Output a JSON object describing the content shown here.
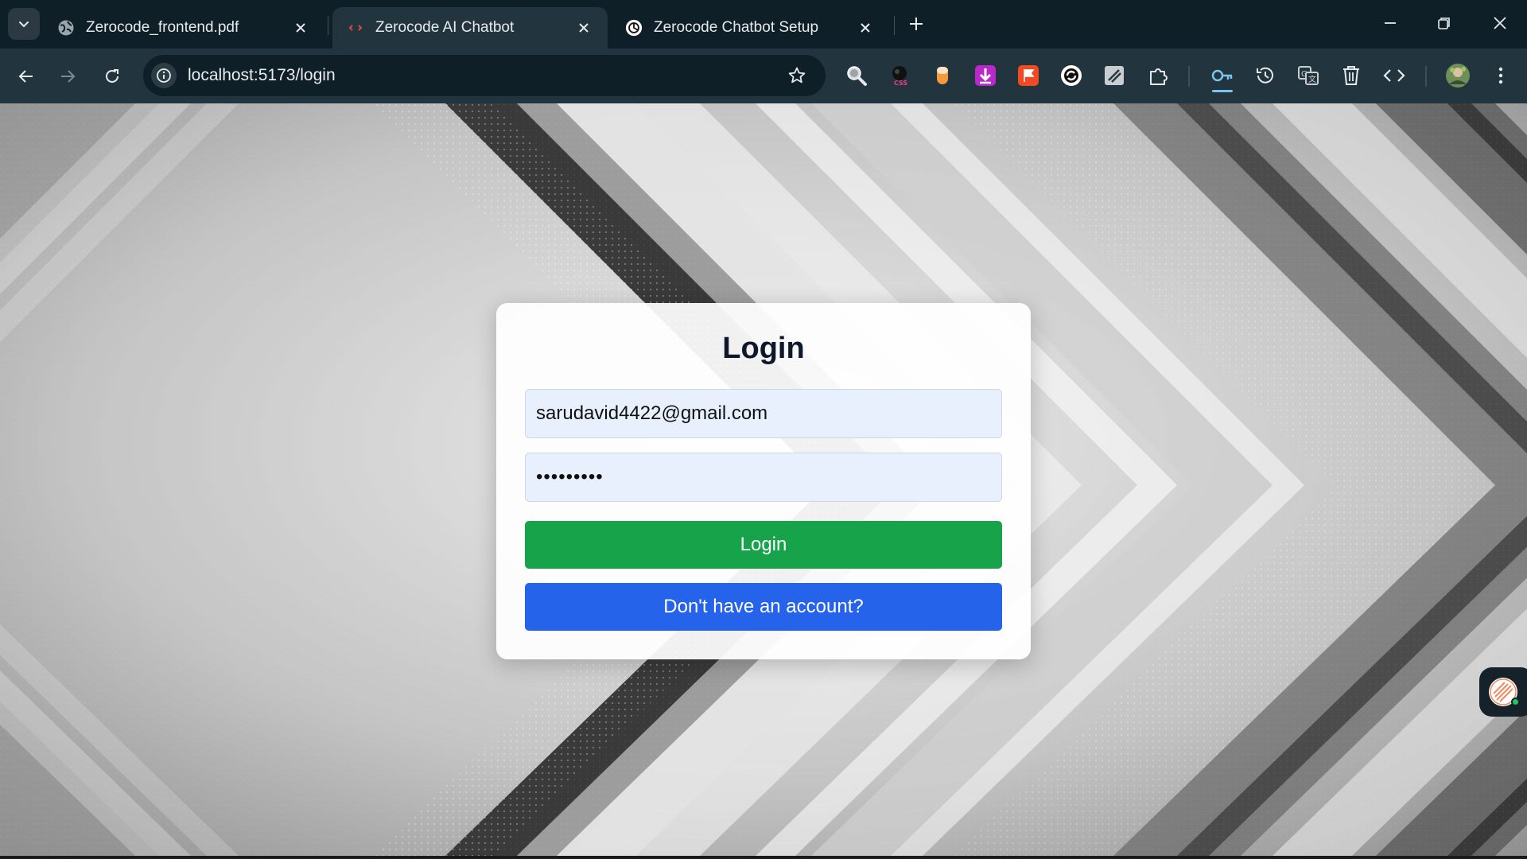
{
  "browser": {
    "tabs": [
      {
        "title": "Zerocode_frontend.pdf",
        "active": false,
        "favicon": "globe-icon"
      },
      {
        "title": "Zerocode AI Chatbot",
        "active": true,
        "favicon": "code-icon"
      },
      {
        "title": "Zerocode Chatbot Setup",
        "active": false,
        "favicon": "openai-icon"
      }
    ],
    "url": "localhost:5173/login",
    "extensions": [
      "magnifier-icon",
      "css-peeper-icon",
      "orange-pill-icon",
      "download-icon",
      "bookmark-flag-icon",
      "sync-icon",
      "notes-icon",
      "puzzle-icon",
      "password-key-icon",
      "history-icon",
      "translate-icon",
      "trash-icon",
      "code-brackets-icon"
    ]
  },
  "login": {
    "title": "Login",
    "email_value": "sarudavid4422@gmail.com",
    "password_value": "sarudavid",
    "login_button": "Login",
    "signup_button": "Don't have an account?"
  },
  "colors": {
    "login_button": "#17a34a",
    "signup_button": "#2563eb",
    "input_bg": "#e8effd",
    "browser_chrome": "#22343d"
  }
}
